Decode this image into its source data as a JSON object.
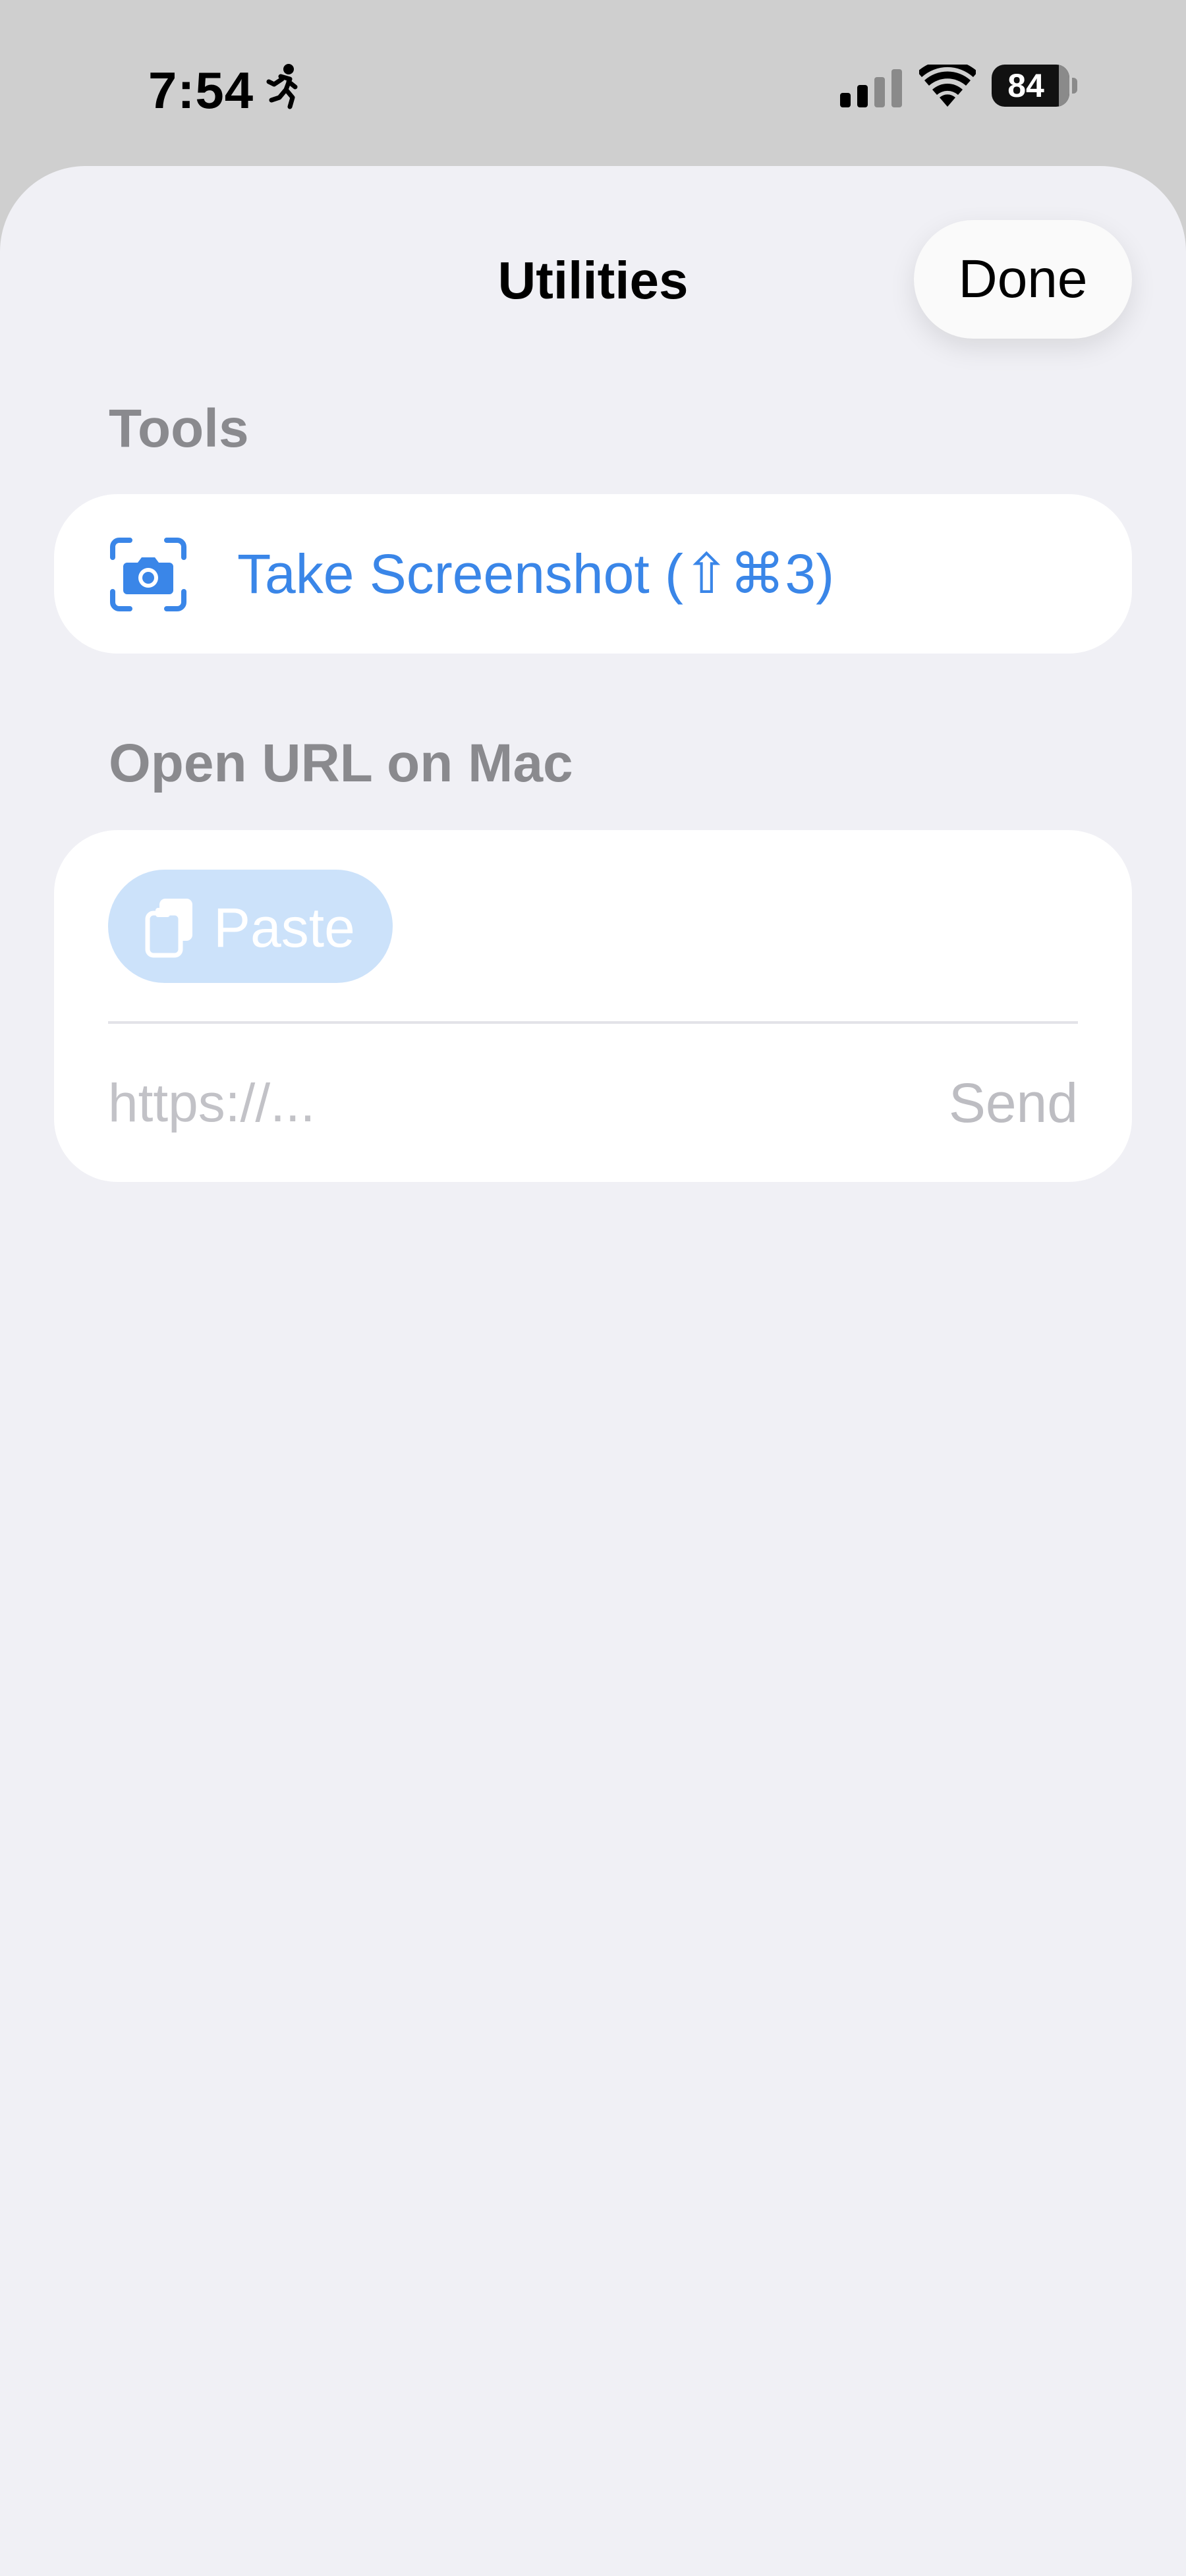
{
  "status_bar": {
    "time": "7:54",
    "battery": "84",
    "icons": [
      "activity-running-icon",
      "cellular-signal-icon",
      "wifi-icon",
      "battery-icon"
    ]
  },
  "sheet": {
    "title": "Utilities",
    "done_label": "Done"
  },
  "tools": {
    "header": "Tools",
    "screenshot_label": "Take Screenshot (⇧⌘3)",
    "screenshot_icon": "camera-viewfinder-icon"
  },
  "open_url": {
    "header": "Open URL on Mac",
    "paste_label": "Paste",
    "paste_icon": "clipboard-copy-icon",
    "url_value": "",
    "url_placeholder": "https://...",
    "send_label": "Send"
  },
  "colors": {
    "accent": "#3a86e8",
    "paste_bg": "#cce2fa",
    "sheet_bg": "#f0f0f5",
    "header_gray": "#8a8a8e",
    "disabled_gray": "#bdbdc2"
  }
}
